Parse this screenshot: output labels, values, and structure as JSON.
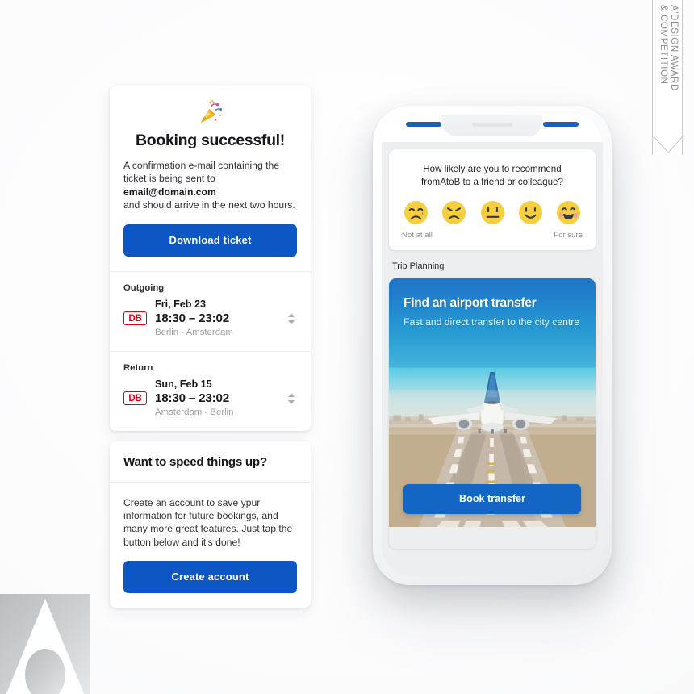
{
  "award_ribbon": {
    "line1": "A'DESIGN AWARD",
    "line2": "& COMPETITION",
    "text": "A'DESIGN AWARD\n& COMPETITION"
  },
  "booking_card": {
    "icon": "party-popper-emoji",
    "title": "Booking successful!",
    "body_line1": "A confirmation e-mail containing the",
    "body_line2": "ticket is being sent to",
    "email": "email@domain.com",
    "body_line3": "and should arrive in the next two hours.",
    "download_label": "Download ticket"
  },
  "trips": [
    {
      "label": "Outgoing",
      "carrier": "DB",
      "date": "Fri, Feb 23",
      "time": "18:30 – 23:02",
      "route": "Berlin - Amsterdam"
    },
    {
      "label": "Return",
      "carrier": "DB",
      "date": "Sun, Feb 15",
      "time": "18:30 – 23:02",
      "route": "Amsterdam - Berlin"
    }
  ],
  "account_card": {
    "title": "Want to speed things up?",
    "body": "Create an account to save ypur information for future bookings, and many more great features. Just tap the button below and it's done!",
    "create_label": "Create account"
  },
  "phone": {
    "survey": {
      "question_line1": "How likely are you to recommend",
      "question_line2": "fromAtoB to a friend or colleague?",
      "faces": [
        "sad-crying-face-icon",
        "frowning-face-icon",
        "neutral-face-icon",
        "slight-smile-face-icon",
        "grinning-face-icon"
      ],
      "scale_low": "Not at all",
      "scale_high": "For sure"
    },
    "section_label": "Trip Planning",
    "promo": {
      "title": "Find an airport transfer",
      "subtitle": "Fast and direct transfer to the city centre",
      "image": "airplane-on-runway-photo",
      "button_label": "Book transfer"
    }
  },
  "colors": {
    "primary_blue": "#0d57c4",
    "promo_button_blue": "#1366c4",
    "db_red": "#e3000f",
    "page_bg": "#fcfcfd",
    "phone_screen_bg": "#eceef0"
  }
}
